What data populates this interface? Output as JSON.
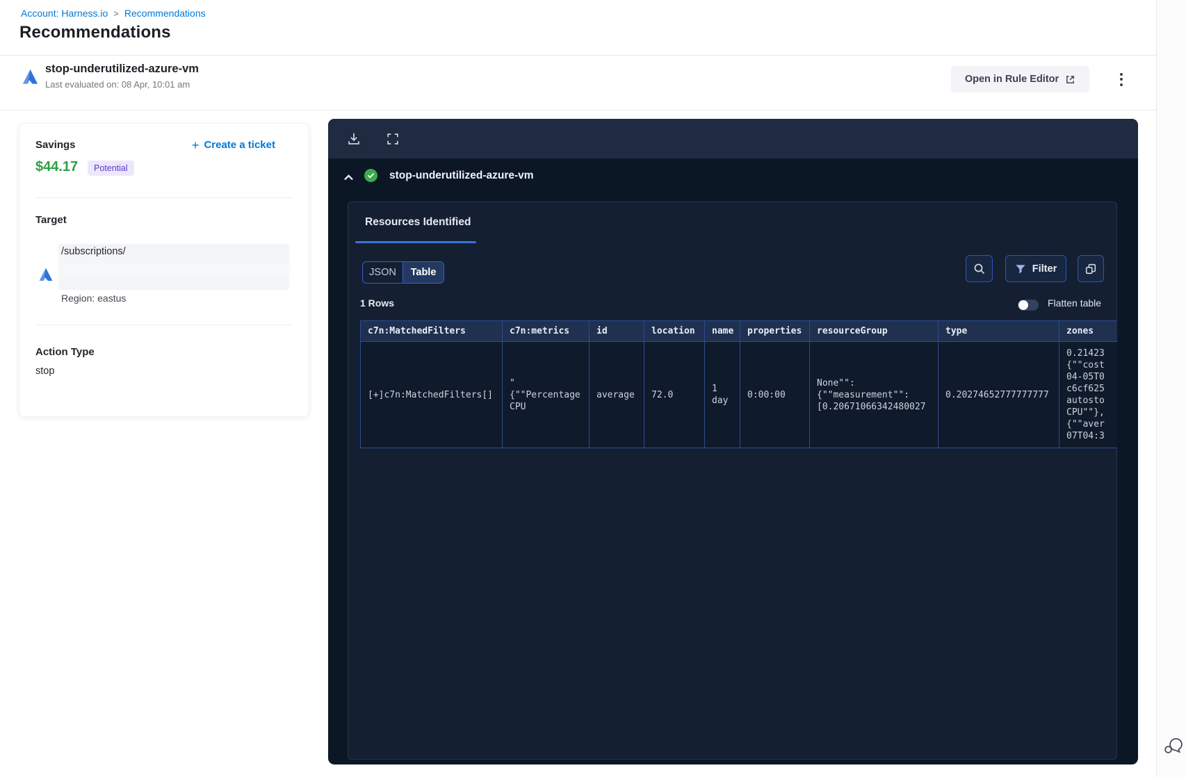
{
  "breadcrumb": {
    "account": "Account: Harness.io",
    "separator": ">",
    "current": "Recommendations"
  },
  "page": {
    "title": "Recommendations"
  },
  "header": {
    "title": "stop-underutilized-azure-vm",
    "subtitle": "Last evaluated on: 08 Apr, 10:01 am",
    "open_rule_editor_label": "Open in Rule Editor"
  },
  "savings_card": {
    "savings_label": "Savings",
    "amount": "$44.17",
    "badge": "Potential",
    "create_ticket_plus": "+",
    "create_ticket_label": "Create a ticket",
    "target_label": "Target",
    "target_path": "/subscriptions/",
    "region": "Region: eastus",
    "action_type_label": "Action Type",
    "action_type_value": "stop"
  },
  "panel": {
    "title": "stop-underutilized-azure-vm",
    "tab": "Resources Identified",
    "view_toggle": {
      "json": "JSON",
      "table": "Table",
      "selected": "Table"
    },
    "filter_label": "Filter",
    "rows_count": "1 Rows",
    "flatten_label": "Flatten table",
    "table": {
      "columns": [
        "c7n:MatchedFilters",
        "c7n:metrics",
        "id",
        "location",
        "name",
        "properties",
        "resourceGroup",
        "type",
        "zones"
      ],
      "row": {
        "c7n_matched_filters": "[+]c7n:MatchedFilters[]",
        "c7n_metrics": "\"\n{\"\"Percentage\nCPU",
        "id": "average",
        "location": "72.0",
        "name": "1\nday",
        "properties": "0:00:00",
        "resource_group": "None\"\":\n{\"\"measurement\"\":\n[0.20671066342480027",
        "type": "0.20274652777777777",
        "zones": "0.21423\n{\"\"cost\n04-05T0\nc6cf625\nautosto\nCPU\"\"},\n{\"\"aver\n07T04:3"
      }
    }
  },
  "icons": [
    "azure-icon",
    "external-link-icon",
    "kebab-menu-icon",
    "download-icon",
    "fullscreen-icon",
    "chevron-up-icon",
    "check-circle-icon",
    "search-icon",
    "filter-funnel-icon",
    "copy-icon",
    "toggle-switch",
    "chat-bubble-icon"
  ],
  "colors": {
    "accent_blue": "#0278d5",
    "savings_green": "#2e9e44",
    "badge_purple_text": "#5a3bc6",
    "badge_purple_bg": "#ece8fb",
    "panel_bg": "#0c1726",
    "panel_toolbar_bg": "#1e2b40",
    "inner_card_bg": "#141f31",
    "table_border_blue": "#2d4d8f",
    "tab_accent": "#3b72d8",
    "success_green": "#3dab4b",
    "matched_filters_link": "#66b5dd"
  }
}
